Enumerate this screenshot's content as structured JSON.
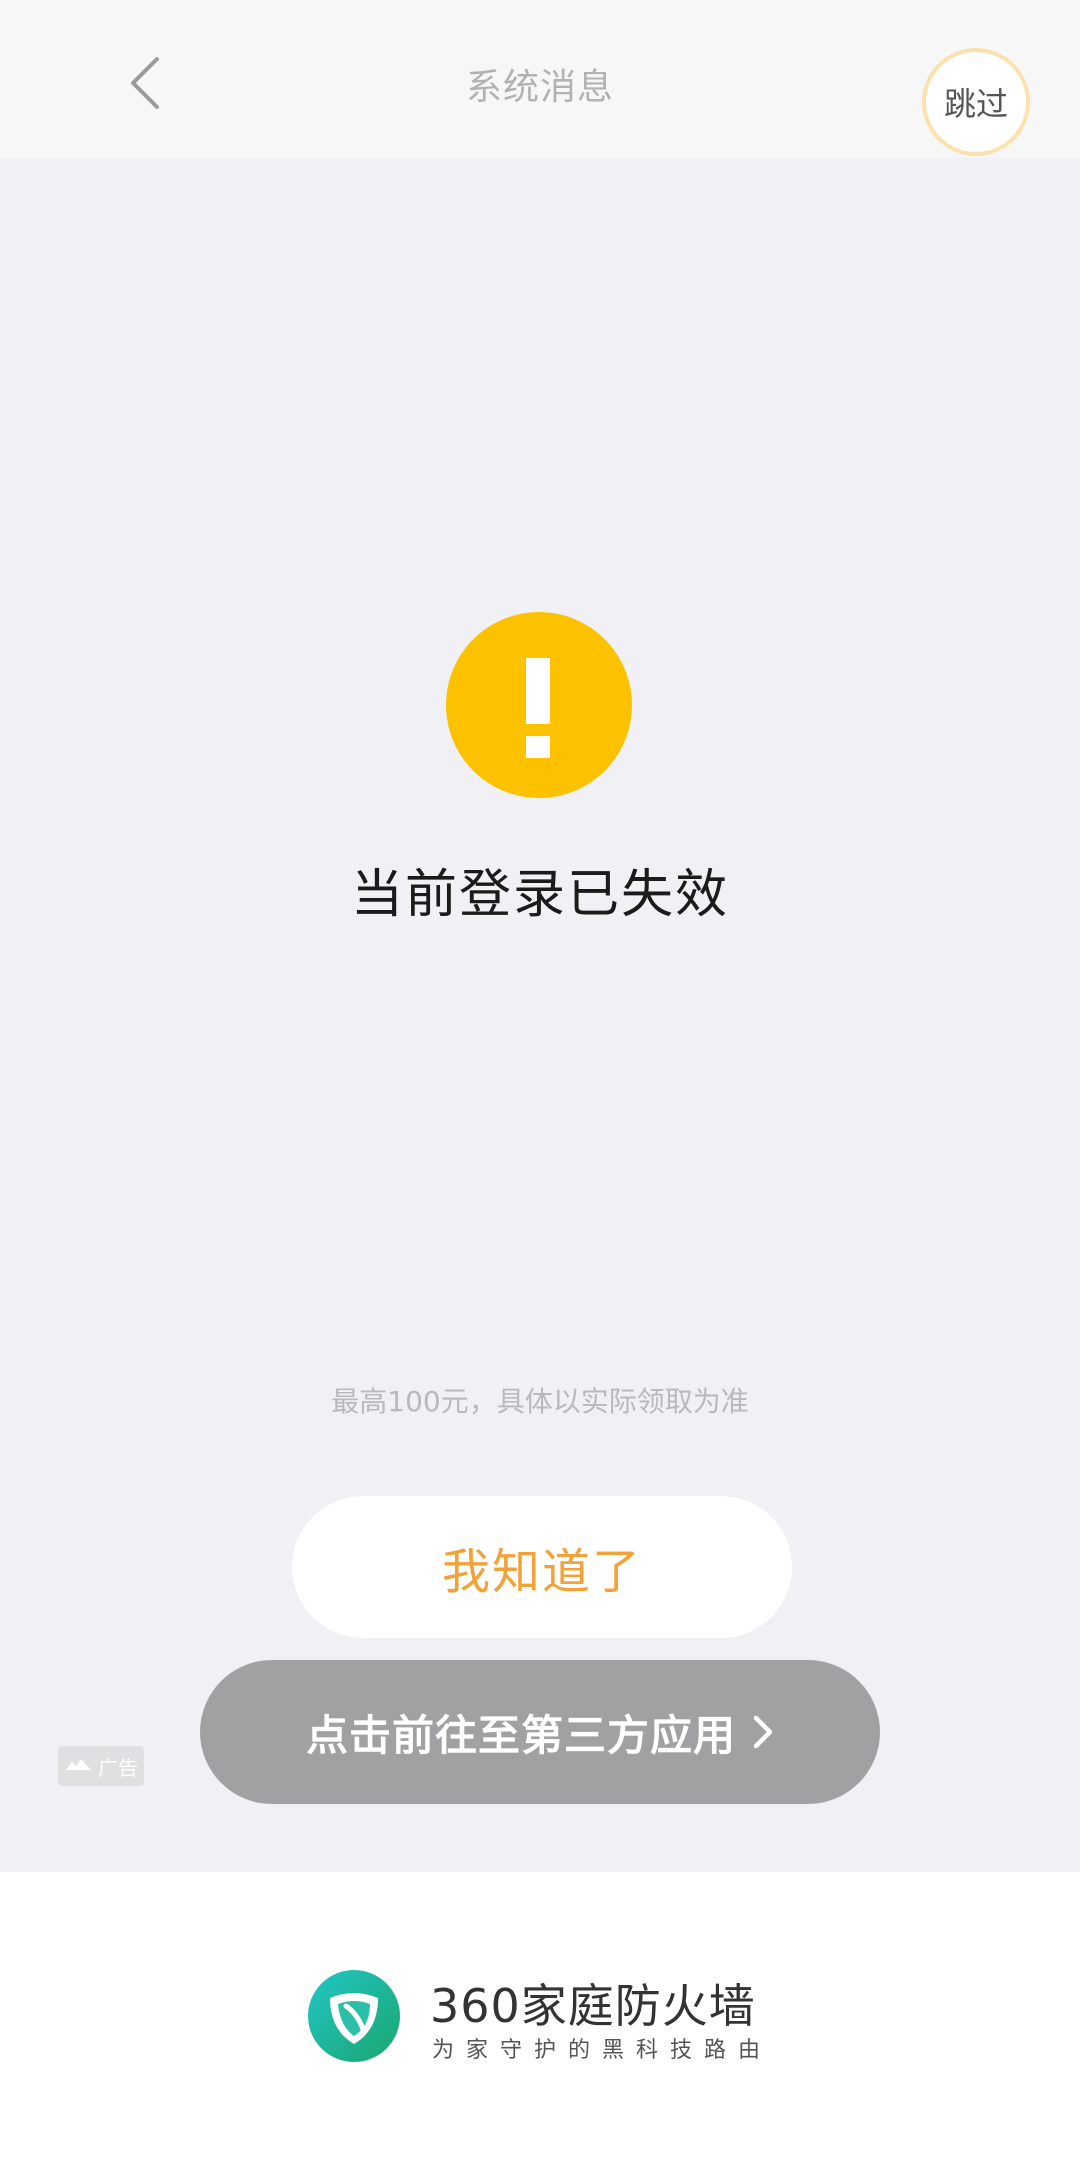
{
  "header": {
    "title": "系统消息",
    "back_icon": "chevron-left-icon",
    "skip_label": "跳过"
  },
  "alert": {
    "icon": "exclamation-icon",
    "icon_color": "#fcc200",
    "message": "当前登录已失效"
  },
  "disclaimer": "最高100元，具体以实际领取为准",
  "buttons": {
    "ok_label": "我知道了",
    "ok_color": "#f1a33a",
    "cta_label": "点击前往至第三方应用",
    "cta_icon": "chevron-right-icon"
  },
  "ad_badge": {
    "label": "广告",
    "icon": "cloud-icon"
  },
  "footer": {
    "brand_name": "360家庭防火墙",
    "tagline": "为家守护的黑科技路由",
    "logo_icon": "shield-logo-icon"
  }
}
